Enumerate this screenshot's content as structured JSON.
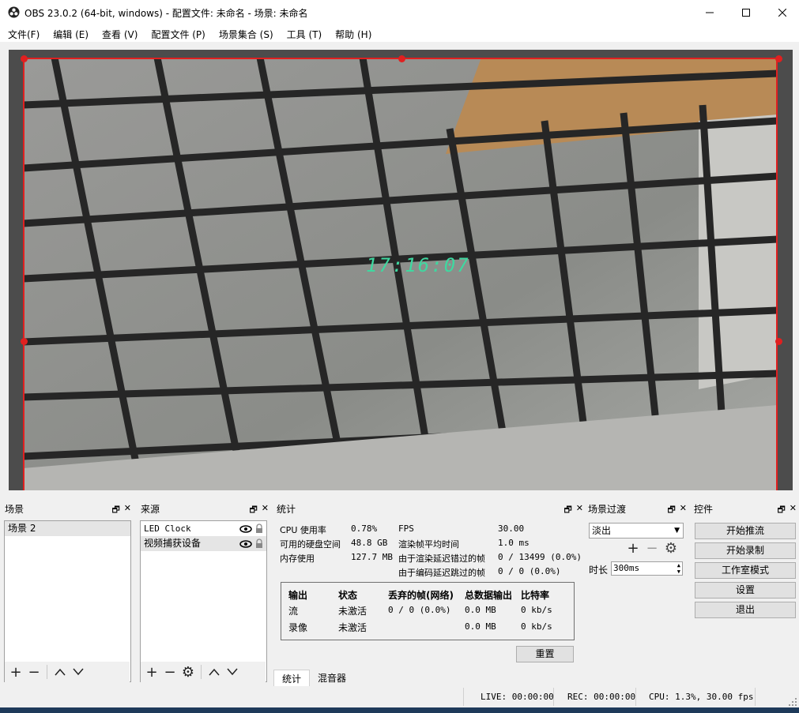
{
  "window": {
    "title": "OBS 23.0.2 (64-bit, windows) - 配置文件: 未命名 - 场景: 未命名"
  },
  "menu": [
    "文件(F)",
    "编辑 (E)",
    "查看 (V)",
    "配置文件 (P)",
    "场景集合 (S)",
    "工具 (T)",
    "帮助 (H)"
  ],
  "preview": {
    "clock": "17:16:07"
  },
  "docks": {
    "scenes": {
      "title": "场景",
      "items": [
        "场景 2"
      ]
    },
    "sources": {
      "title": "来源",
      "items": [
        "LED Clock",
        "视频捕获设备"
      ]
    },
    "stats": {
      "title": "统计"
    },
    "transitions": {
      "title": "场景过渡"
    },
    "controls": {
      "title": "控件"
    }
  },
  "stats": {
    "cpu_label": "CPU 使用率",
    "cpu_value": "0.78%",
    "disk_label": "可用的硬盘空间",
    "disk_value": "48.8 GB",
    "mem_label": "内存使用",
    "mem_value": "127.7 MB",
    "fps_label": "FPS",
    "fps_value": "30.00",
    "render_time_label": "渲染帧平均时间",
    "render_time_value": "1.0 ms",
    "render_skip_label": "由于渲染延迟错过的帧",
    "render_skip_value": "0 / 13499 (0.0%)",
    "encode_skip_label": "由于编码延迟跳过的帧",
    "encode_skip_value": "0 / 0 (0.0%)",
    "table": {
      "headers": [
        "输出",
        "状态",
        "丢弃的帧(网络)",
        "总数据输出",
        "比特率"
      ],
      "rows": [
        [
          "流",
          "未激活",
          "0 / 0 (0.0%)",
          "0.0 MB",
          "0 kb/s"
        ],
        [
          "录像",
          "未激活",
          "",
          "0.0 MB",
          "0 kb/s"
        ]
      ]
    },
    "reset_label": "重置",
    "tabs": [
      "统计",
      "混音器"
    ]
  },
  "transitions": {
    "selected": "淡出",
    "duration_label": "时长",
    "duration_value": "300ms"
  },
  "controls": {
    "buttons": [
      "开始推流",
      "开始录制",
      "工作室模式",
      "设置",
      "退出"
    ]
  },
  "status": {
    "live": "LIVE: 00:00:00",
    "rec": "REC: 00:00:00",
    "cpu": "CPU: 1.3%, 30.00 fps"
  },
  "colors": {
    "selection": "#e02020",
    "clock": "#3fd8a0"
  }
}
